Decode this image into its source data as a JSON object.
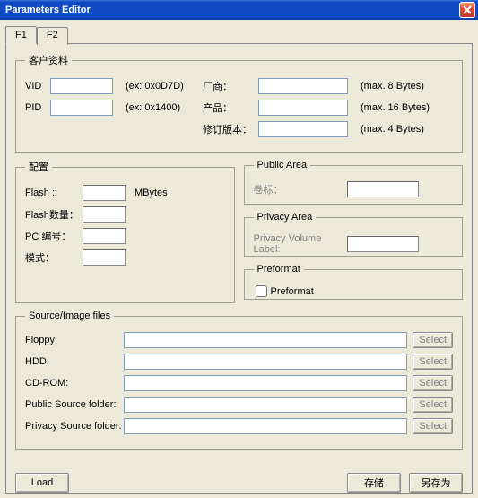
{
  "window": {
    "title": "Parameters Editor"
  },
  "tabs": [
    {
      "label": "F1"
    },
    {
      "label": "F2"
    }
  ],
  "customer": {
    "legend": "客户资料",
    "vid_label": "VID",
    "vid_value": "",
    "vid_hint": "(ex: 0x0D7D)",
    "pid_label": "PID",
    "pid_value": "",
    "pid_hint": "(ex: 0x1400)",
    "mfr_label": "厂商：",
    "mfr_value": "",
    "mfr_hint": "(max. 8 Bytes)",
    "prod_label": "产品：",
    "prod_value": "",
    "prod_hint": "(max. 16 Bytes)",
    "rev_label": "修订版本：",
    "rev_value": "",
    "rev_hint": "(max. 4 Bytes)"
  },
  "config": {
    "legend": "配置",
    "flash_label": "Flash :",
    "flash_value": "",
    "flash_unit": "MBytes",
    "flash_qty_label": "Flash数量：",
    "flash_qty_value": "",
    "pc_label": "PC 编号：",
    "pc_value": "",
    "mode_label": "模式：",
    "mode_value": ""
  },
  "public_area": {
    "legend": "Public Area",
    "vol_label": "卷标：",
    "vol_value": ""
  },
  "privacy_area": {
    "legend": "Privacy Area",
    "vol_label": "Privacy Volume Label:",
    "vol_value": ""
  },
  "preformat": {
    "legend": "Preformat",
    "checkbox_label": "Preformat"
  },
  "source": {
    "legend": "Source/Image files",
    "floppy_label": "Floppy:",
    "hdd_label": "HDD:",
    "cdrom_label": "CD-ROM:",
    "pub_label": "Public Source folder:",
    "priv_label": "Privacy Source folder:",
    "select_label": "Select"
  },
  "buttons": {
    "load": "Load",
    "save": "存储",
    "save_as": "另存为"
  }
}
